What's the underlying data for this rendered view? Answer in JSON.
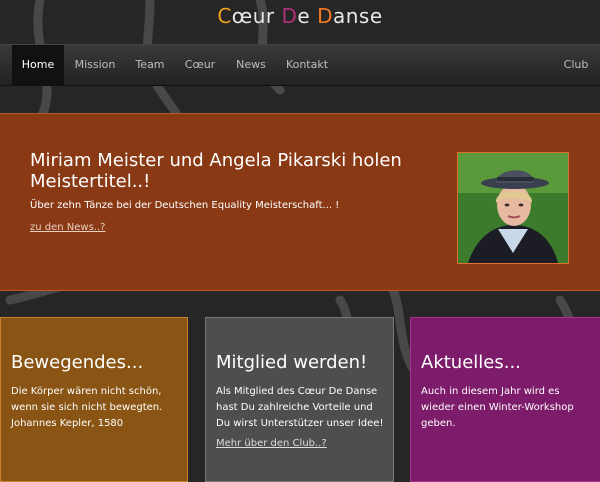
{
  "logo": {
    "part1_letter": "C",
    "part1_rest": "œur ",
    "part2_letter": "D",
    "part2_rest": "e ",
    "part3_letter": "D",
    "part3_rest": "anse"
  },
  "nav": {
    "items": [
      "Home",
      "Mission",
      "Team",
      "Cœur",
      "News",
      "Kontakt"
    ],
    "active": "Home",
    "right": "Club"
  },
  "hero": {
    "title": "Miriam Meister und Angela Pikarski holen Meistertitel..!",
    "subtitle": "Über zehn Tänze bei der Deutschen Equality Meisterschaft... !",
    "link": "zu den News..?"
  },
  "boxes": [
    {
      "title": "Bewegendes...",
      "text": "Die Körper wären nicht schön, wenn sie sich nicht bewegten. Johannes Kepler, 1580",
      "color": "#8a5514"
    },
    {
      "title": "Mitglied werden!",
      "text": "Als Mitglied des Cœur De Danse hast Du zahlreiche Vorteile und Du wirst Unterstützer unser Idee!",
      "link": "Mehr über den Club..?",
      "color": "#4e4e4e"
    },
    {
      "title": "Aktuelles...",
      "text": "Auch in diesem Jahr wird es wieder einen Winter-Workshop geben.",
      "color": "#7c1c6a"
    }
  ],
  "colors": {
    "accent_orange": "#f0a020",
    "accent_purple": "#b0307a",
    "hero_bg": "#8c3a14"
  }
}
